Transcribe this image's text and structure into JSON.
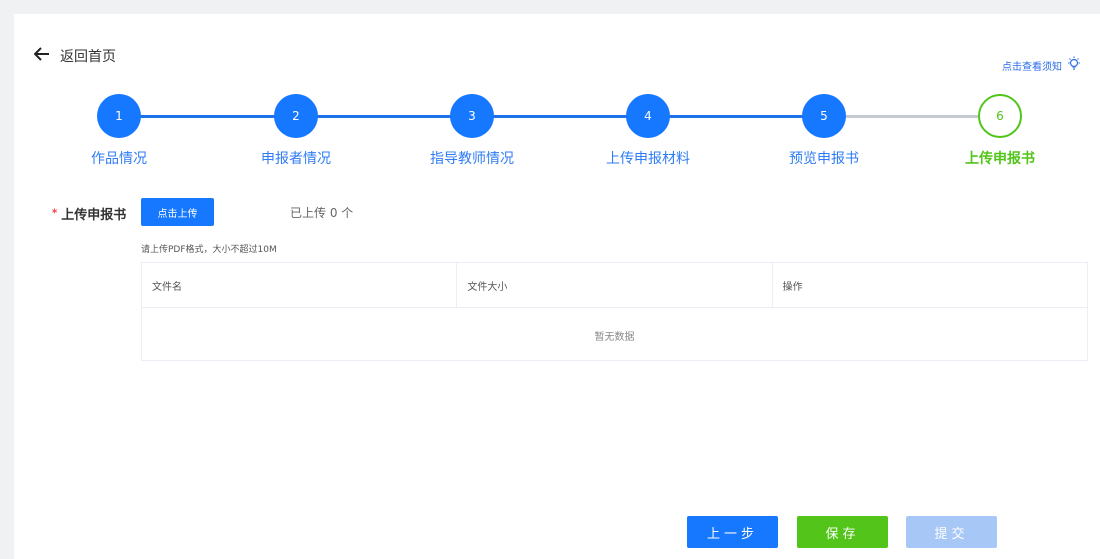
{
  "header": {
    "back_label": "返回首页",
    "notice_label": "点击查看须知"
  },
  "steps": [
    {
      "number": "1",
      "label": "作品情况",
      "state": "done"
    },
    {
      "number": "2",
      "label": "申报者情况",
      "state": "done"
    },
    {
      "number": "3",
      "label": "指导教师情况",
      "state": "done"
    },
    {
      "number": "4",
      "label": "上传申报材料",
      "state": "done"
    },
    {
      "number": "5",
      "label": "预览申报书",
      "state": "done"
    },
    {
      "number": "6",
      "label": "上传申报书",
      "state": "current"
    }
  ],
  "upload": {
    "required_mark": "*",
    "label": "上传申报书",
    "button_label": "点击上传",
    "uploaded_text": "已上传 0 个",
    "hint": "请上传PDF格式，大小不超过10M"
  },
  "table": {
    "columns": [
      "文件名",
      "文件大小",
      "操作"
    ],
    "empty_text": "暂无数据"
  },
  "footer": {
    "prev_label": "上一步",
    "save_label": "保存",
    "submit_label": "提交"
  },
  "colors": {
    "primary": "#1677ff",
    "success": "#52c41a",
    "disabled": "#a7c8f7"
  }
}
